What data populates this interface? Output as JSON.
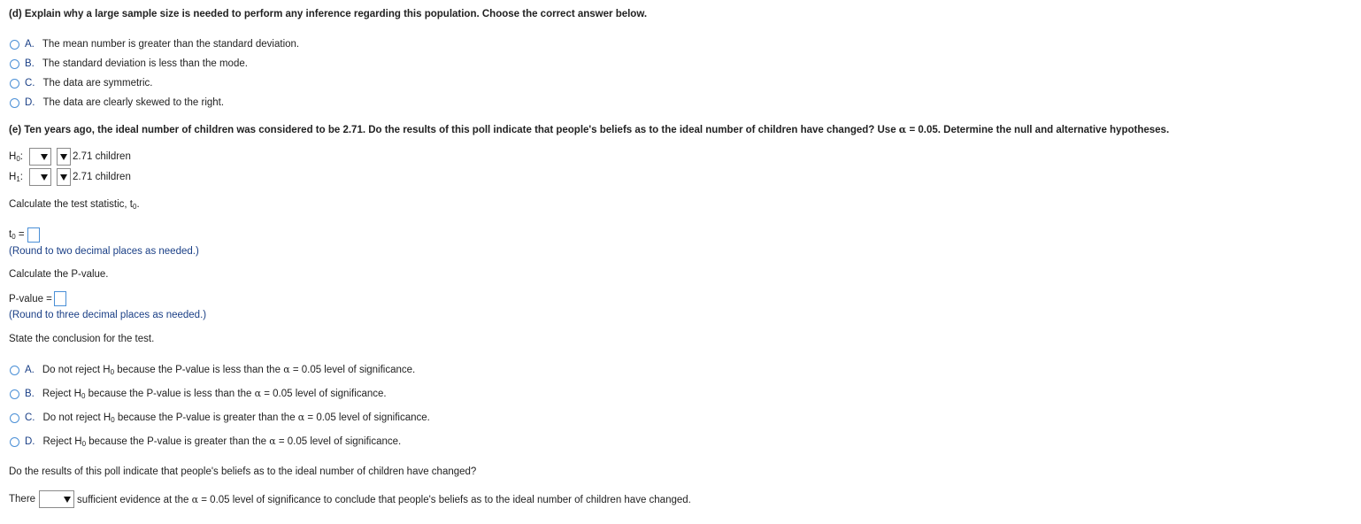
{
  "part_d": {
    "question": "(d) Explain why a large sample size is needed to perform any inference regarding this population. Choose the correct answer below.",
    "options": [
      {
        "letter": "A.",
        "text": "The mean number is greater than the standard deviation."
      },
      {
        "letter": "B.",
        "text": "The standard deviation is less than the mode."
      },
      {
        "letter": "C.",
        "text": "The data are symmetric."
      },
      {
        "letter": "D.",
        "text": "The data are clearly skewed to the right."
      }
    ]
  },
  "part_e": {
    "question_start": "(e) Ten years ago, the ideal number of children was considered to be 2.71. Do the results of this poll indicate that people's beliefs as to the ideal number of children have changed? Use ",
    "alpha": "α",
    "alpha_eq": " = 0.05",
    "question_end": ". Determine the null and alternative hypotheses.",
    "h0": {
      "label": "H",
      "sub": "0",
      "suffix": ":",
      "value_text": "2.71 children"
    },
    "h1": {
      "label": "H",
      "sub": "1",
      "suffix": ":",
      "value_text": "2.71 children"
    },
    "test_stat_prompt": "Calculate the test statistic, t",
    "test_stat_sub": "0",
    "test_stat_end": ".",
    "t0_label": "t",
    "t0_sub": "0",
    "t0_eq": " =",
    "t0_hint": "(Round to two decimal places as needed.)",
    "pvalue_prompt": "Calculate the P-value.",
    "pvalue_label": "P-value =",
    "pvalue_hint": "(Round to three decimal places as needed.)",
    "conclusion_prompt": "State the conclusion for the test.",
    "conclusions": [
      {
        "letter": "A.",
        "pre": "Do not reject H",
        "sub": "0",
        "post": " because the P-value is less than the ",
        "alpha": "α",
        "tail": " = 0.05 level of significance."
      },
      {
        "letter": "B.",
        "pre": "Reject H",
        "sub": "0",
        "post": " because the P-value is less than the ",
        "alpha": "α",
        "tail": " = 0.05 level of significance."
      },
      {
        "letter": "C.",
        "pre": "Do not reject H",
        "sub": "0",
        "post": " because the P-value is greater than the ",
        "alpha": "α",
        "tail": " = 0.05 level of significance."
      },
      {
        "letter": "D.",
        "pre": "Reject H",
        "sub": "0",
        "post": " because the P-value is greater than the ",
        "alpha": "α",
        "tail": " = 0.05 level of significance."
      }
    ],
    "final_question": "Do the results of this poll indicate that people's beliefs as to the ideal number of children have changed?",
    "final_pre": "There",
    "final_post_a": "sufficient evidence at the ",
    "final_alpha": "α",
    "final_post_b": " = 0.05 level of significance to conclude that people's beliefs as to the ideal number of children have changed."
  },
  "colors": {
    "radio_border": "#4a8fd6",
    "hint_text": "#1a3f86"
  }
}
